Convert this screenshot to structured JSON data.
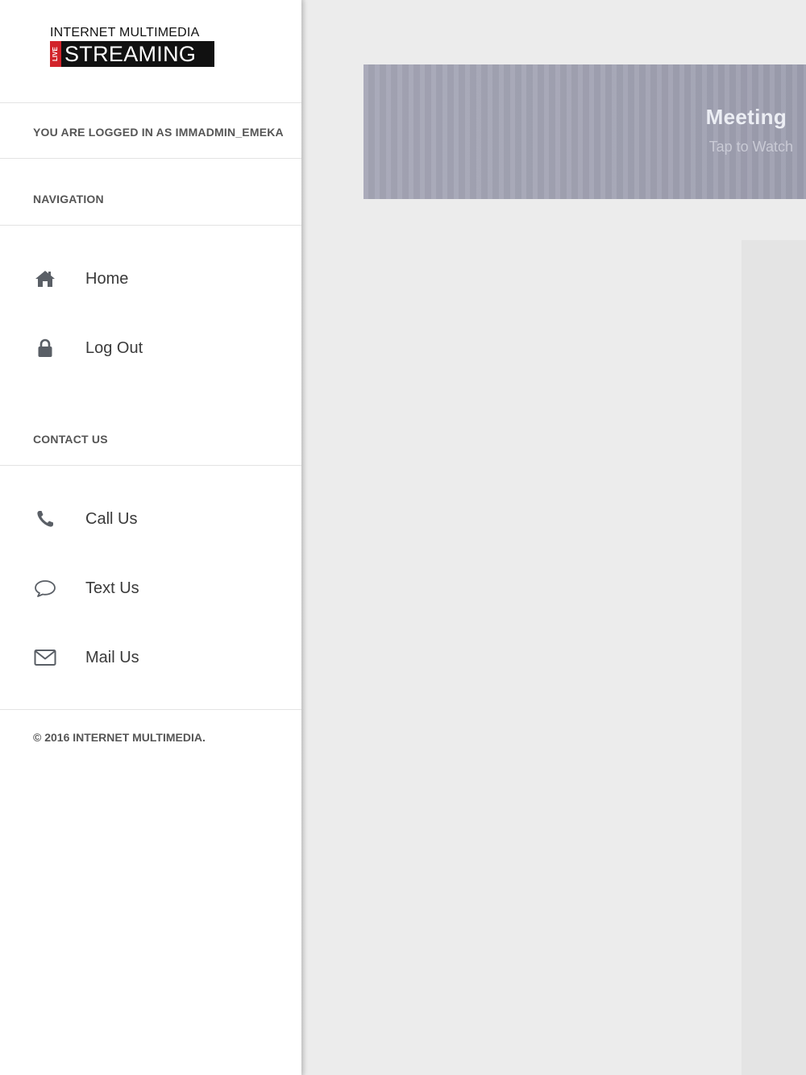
{
  "logo": {
    "top_line": "INTERNET MULTIMEDIA",
    "live_tag": "LIVE",
    "bottom_line": "STREAMING"
  },
  "drawer": {
    "logged_in_text": "YOU ARE LOGGED IN AS IMMADMIN_EMEKA",
    "navigation_header": "NAVIGATION",
    "nav_items": [
      {
        "label": "Home",
        "icon": "home-icon"
      },
      {
        "label": "Log Out",
        "icon": "lock-icon"
      }
    ],
    "contact_header": "CONTACT US",
    "contact_items": [
      {
        "label": "Call Us",
        "icon": "phone-icon"
      },
      {
        "label": "Text Us",
        "icon": "chat-bubble-icon"
      },
      {
        "label": "Mail Us",
        "icon": "mail-icon"
      }
    ],
    "footer": "© 2016 INTERNET MULTIMEDIA."
  },
  "main": {
    "banner_title": "Meeting",
    "banner_subtitle": "Tap to Watch"
  },
  "colors": {
    "icon": "#5a5f66",
    "text": "#3a3a3a",
    "section_label": "#555555",
    "live_red": "#d2232a"
  }
}
